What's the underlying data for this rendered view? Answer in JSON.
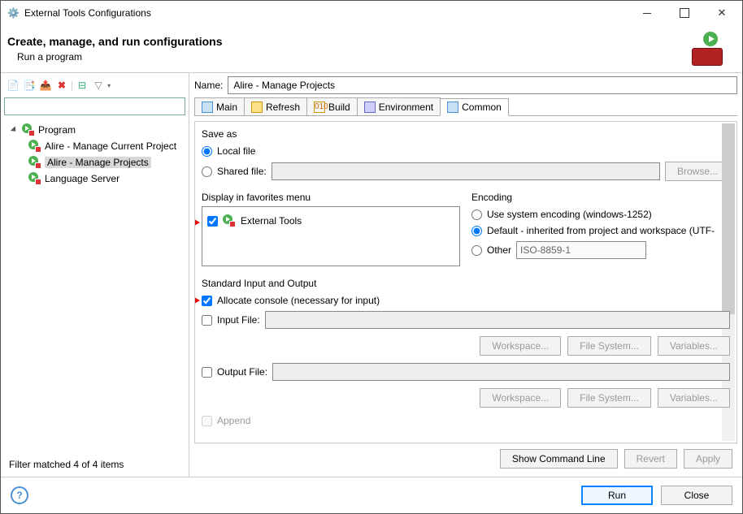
{
  "window": {
    "title": "External Tools Configurations"
  },
  "header": {
    "title": "Create, manage, and run configurations",
    "subtitle": "Run a program"
  },
  "toolbar": {
    "new_icon": "📄",
    "dup_icon": "📑",
    "export_icon": "📤",
    "delete_icon": "✖",
    "delete_color": "#d33",
    "expand_icon": "⊟",
    "filter_icon": "▽"
  },
  "tree": {
    "root": "Program",
    "items": [
      {
        "label": "Alire - Manage Current Project"
      },
      {
        "label": "Alire - Manage Projects",
        "selected": true
      },
      {
        "label": "Language Server"
      }
    ]
  },
  "filter_status": "Filter matched 4 of 4 items",
  "name_field": {
    "label": "Name:",
    "value": "Alire - Manage Projects"
  },
  "tabs": {
    "main": "Main",
    "refresh": "Refresh",
    "build": "Build",
    "environment": "Environment",
    "common": "Common"
  },
  "save_as": {
    "heading": "Save as",
    "local": "Local file",
    "shared": "Shared file:",
    "browse": "Browse..."
  },
  "favorites": {
    "heading": "Display in favorites menu",
    "item": "External Tools"
  },
  "encoding": {
    "heading": "Encoding",
    "system": "Use system encoding (windows-1252)",
    "default": "Default - inherited from project and workspace (UTF-",
    "other": "Other",
    "other_value": "ISO-8859-1"
  },
  "stdio": {
    "heading": "Standard Input and Output",
    "allocate": "Allocate console (necessary for input)",
    "input_file": "Input File:",
    "output_file": "Output File:",
    "append": "Append",
    "workspace": "Workspace...",
    "filesystem": "File System...",
    "variables": "Variables..."
  },
  "bottom": {
    "show_cmd": "Show Command Line",
    "revert": "Revert",
    "apply": "Apply"
  },
  "footer": {
    "run": "Run",
    "close": "Close"
  }
}
